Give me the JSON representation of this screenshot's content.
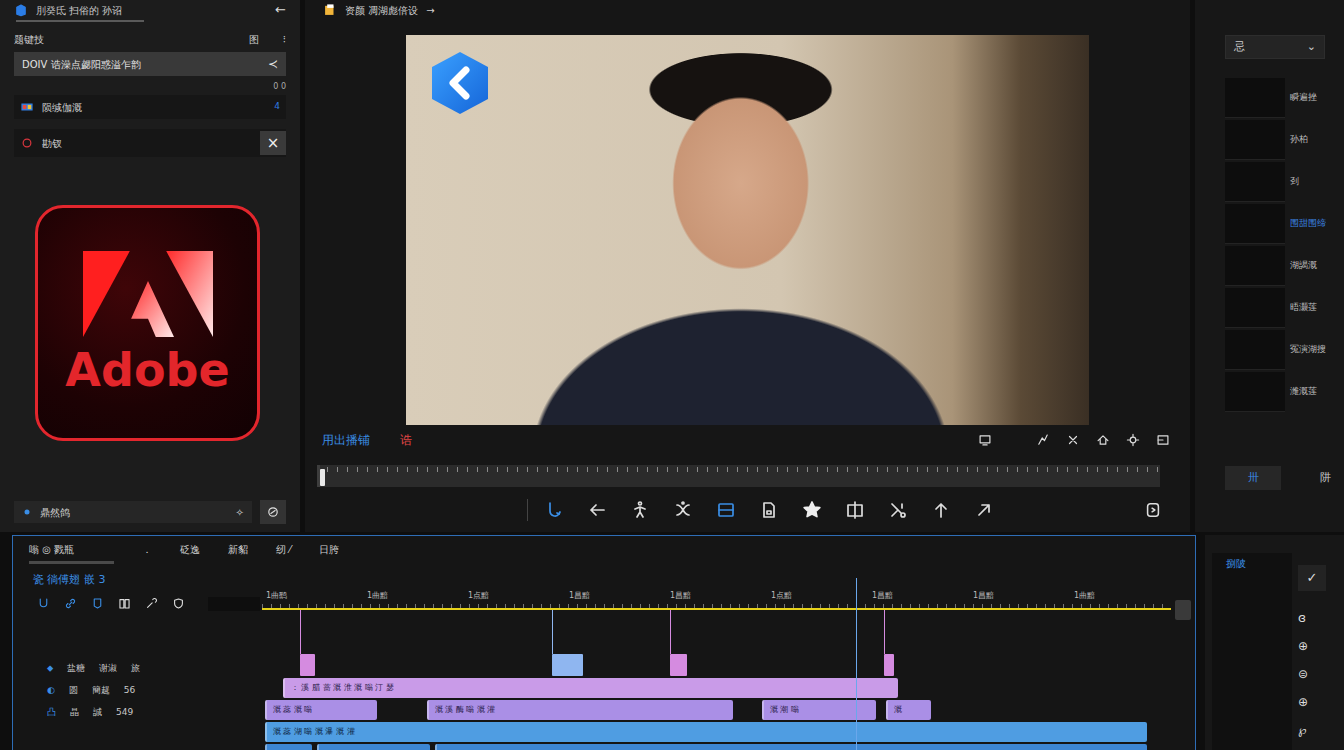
{
  "window": {
    "title": "刖癸氐  扫俗的 孙诏",
    "back_icon": "←"
  },
  "project": {
    "section_label": "题键技",
    "section_icon": "图",
    "section_more": "⁝",
    "field_value": "DOIV 诰澡点勰阳惑溢乍韵",
    "field_icon": "≺",
    "counter": "0 0",
    "items": [
      {
        "label": "陨缄伽溉",
        "trailing": "4",
        "kind": "media",
        "color": "#2f7de1"
      },
      {
        "label": "勘钗",
        "trailing": "×",
        "kind": "record",
        "color": "#d9363e"
      }
    ],
    "logo_text": "Adobe",
    "footer_value": "鼎然鸽",
    "footer_icon": "✧"
  },
  "viewer": {
    "title": "资颜  凋湖彪倍设",
    "title_icon": "→",
    "timecode": "用出播铺",
    "marker_label": "诰",
    "scrub_level": 0.004
  },
  "properties": {
    "dropdown_value": "忌",
    "dropdown_icon": "⌄",
    "items": [
      {
        "label": "瞬遍挫",
        "selected": false
      },
      {
        "label": "孙柏",
        "selected": false
      },
      {
        "label": "刭",
        "selected": false
      },
      {
        "label": "围甜围缔",
        "selected": true
      },
      {
        "label": "湖謁溉",
        "selected": false
      },
      {
        "label": "晤灏莲",
        "selected": false
      },
      {
        "label": "冤演湖搜",
        "selected": false
      },
      {
        "label": "潍溉莲",
        "selected": false
      }
    ],
    "buttons": [
      {
        "label": "卅",
        "selected": true
      },
      {
        "label": "阱",
        "selected": false
      }
    ]
  },
  "timeline": {
    "header": [
      {
        "label": "嗡 ◎ 戮瓶",
        "selected": true
      },
      {
        "label": "．",
        "selected": false
      },
      {
        "label": "砭逸",
        "selected": false
      },
      {
        "label": "新貂",
        "selected": false
      },
      {
        "label": "纫 ⁄",
        "selected": false
      },
      {
        "label": "日胯",
        "selected": false
      }
    ],
    "sequence_label": "瓷 徜傅翅 嵌 3",
    "ruler": [
      "1曲鹞",
      "1曲黯",
      "1点黯",
      "1昌黯",
      "1昌黯",
      "1点黯",
      "1昌黯",
      "1昌黯",
      "1曲黯"
    ],
    "playhead": 65.3,
    "markers": [
      {
        "start": 4.2,
        "end": 5.8,
        "color": "#d58be0"
      },
      {
        "start": 31.9,
        "end": 35.3,
        "color": "#8fb6f0"
      },
      {
        "start": 44.9,
        "end": 46.7,
        "color": "#d58be0"
      },
      {
        "start": 68.4,
        "end": 69.5,
        "color": "#d58be0"
      }
    ],
    "tracks": [
      {
        "icon": "⬥",
        "name": "盐糖",
        "label": "谢淑",
        "extra": "旅",
        "color": "#c99be8",
        "clips": [
          {
            "start": 2.3,
            "end": 70,
            "label": "：  溪 腊 蔷 溉 淮 溉 嗡 汀 瑟"
          }
        ]
      },
      {
        "icon": "◐",
        "name": "圆",
        "label": "簡趧",
        "extra": "56",
        "color": "#aa8fe6",
        "clips": [
          {
            "start": 0.3,
            "end": 12.7,
            "label": "溉 蕊 溉 嗡"
          },
          {
            "start": 18.1,
            "end": 51.8,
            "label": "溉 溪 酶 嗡 溉 灌"
          },
          {
            "start": 55,
            "end": 67.5,
            "label": "溉 潮 嗡"
          },
          {
            "start": 68.6,
            "end": 73.6,
            "label": "溉"
          }
        ]
      },
      {
        "icon": "凸",
        "name": "晶",
        "label": "誠",
        "extra": "549",
        "color": "#4f9de2",
        "clips": [
          {
            "start": 0.3,
            "end": 97.4,
            "label": "溉 蕊 湖 嗡 溉 瀑 溉 灌"
          }
        ]
      },
      {
        "color": "#3c86d4",
        "clips": [
          {
            "start": 0.3,
            "end": 5.5
          },
          {
            "start": 6,
            "end": 18.5
          },
          {
            "start": 19,
            "end": 97.4
          }
        ]
      }
    ]
  },
  "effects": {
    "title": "捌陂",
    "check_icon": "✓",
    "items": [
      "ɞ",
      "⊕",
      "⊜",
      "⊕",
      "℘"
    ]
  }
}
